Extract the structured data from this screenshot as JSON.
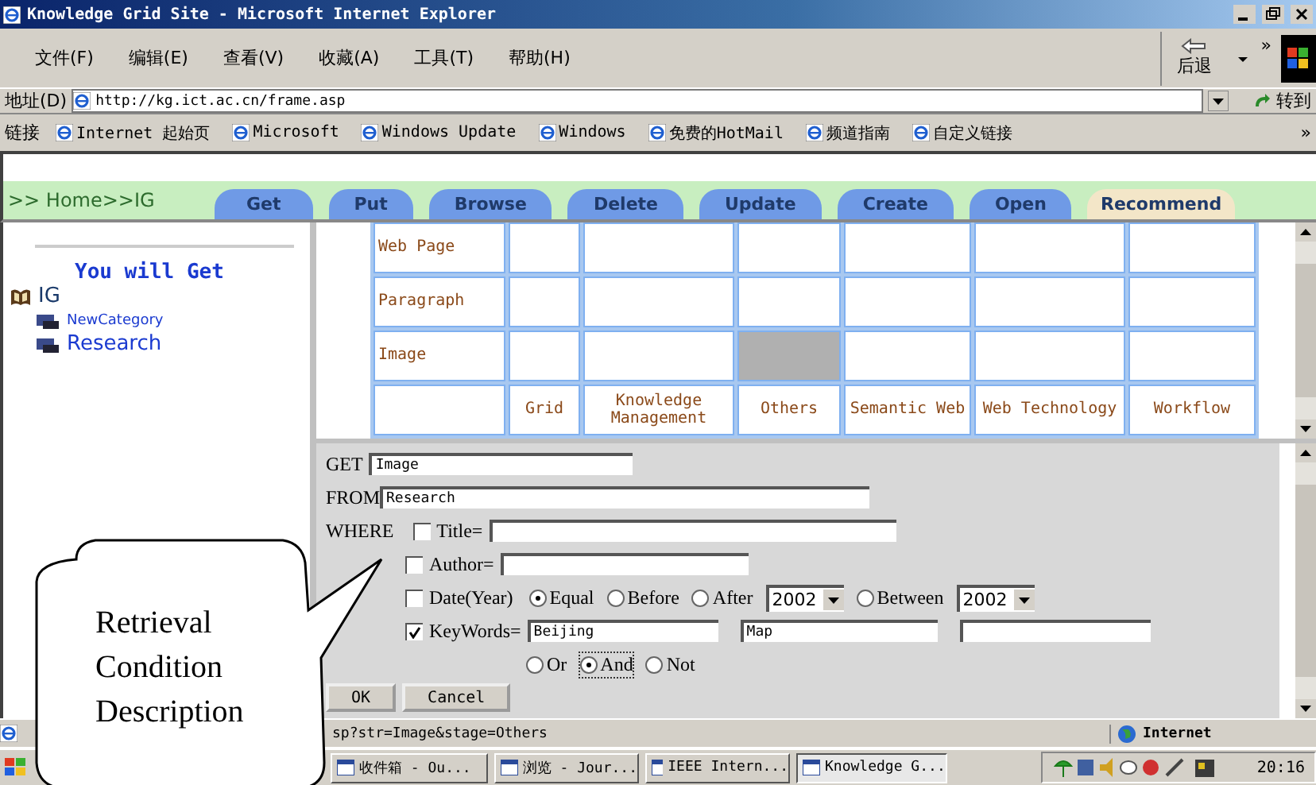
{
  "window": {
    "title": "Knowledge Grid Site - Microsoft Internet Explorer"
  },
  "menu": [
    "文件(F)",
    "编辑(E)",
    "查看(V)",
    "收藏(A)",
    "工具(T)",
    "帮助(H)"
  ],
  "back_button": {
    "label": "后退"
  },
  "chevron": "»",
  "address": {
    "label": "地址(D)",
    "url": "http://kg.ict.ac.cn/frame.asp",
    "go": "转到"
  },
  "links": {
    "label": "链接",
    "items": [
      "Internet 起始页",
      "Microsoft",
      "Windows Update",
      "Windows",
      "免费的HotMail",
      "频道指南",
      "自定义链接"
    ],
    "more": "»"
  },
  "nav": {
    "breadcrumb": ">> Home>>IG",
    "tabs": [
      {
        "label": "Get",
        "kind": "tab"
      },
      {
        "label": "Put",
        "kind": "tab"
      },
      {
        "label": "Browse",
        "kind": "tab"
      },
      {
        "label": "Delete",
        "kind": "tab"
      },
      {
        "label": "Update",
        "kind": "tab"
      },
      {
        "label": "Create",
        "kind": "tab"
      },
      {
        "label": "Open",
        "kind": "tab"
      },
      {
        "label": "Recommend",
        "kind": "plain"
      }
    ]
  },
  "sidebar": {
    "heading": "You will Get",
    "tree": [
      {
        "label": "IG",
        "children": [
          {
            "label": "NewCategory",
            "selected": false
          },
          {
            "label": "Research",
            "selected": true
          }
        ]
      }
    ]
  },
  "grid": {
    "columns": [
      "Grid",
      "Knowledge Management",
      "Others",
      "Semantic Web",
      "Web Technology",
      "Workflow"
    ],
    "rows": [
      {
        "label": "Web Page",
        "cells": [
          {
            "selected": false
          },
          {
            "selected": false
          },
          {
            "selected": false
          },
          {
            "selected": false
          },
          {
            "selected": false
          },
          {
            "selected": false
          }
        ]
      },
      {
        "label": "Paragraph",
        "cells": [
          {
            "selected": false
          },
          {
            "selected": false
          },
          {
            "selected": false
          },
          {
            "selected": false
          },
          {
            "selected": false
          },
          {
            "selected": false
          }
        ]
      },
      {
        "label": "Image",
        "cells": [
          {
            "selected": false
          },
          {
            "selected": false
          },
          {
            "selected": true
          },
          {
            "selected": false
          },
          {
            "selected": false
          },
          {
            "selected": false
          }
        ]
      }
    ]
  },
  "form": {
    "get": {
      "label": "GET",
      "value": "Image"
    },
    "from": {
      "label": "FROM",
      "value": "Research"
    },
    "where_label": "WHERE",
    "conditions": [
      {
        "kind": "text",
        "label": "Title=",
        "checked": false
      },
      {
        "kind": "text",
        "label": "Author=",
        "checked": false
      },
      {
        "kind": "date",
        "label": "Date(Year)",
        "checked": false,
        "options": [
          {
            "kind": "radio",
            "label": "Equal",
            "selected": true
          },
          {
            "kind": "radio",
            "label": "Before",
            "selected": false
          },
          {
            "kind": "radio",
            "label": "After",
            "selected": false
          },
          {
            "kind": "select",
            "value": "2002"
          },
          {
            "kind": "radio",
            "label": "Between",
            "selected": false
          },
          {
            "kind": "select",
            "value": "2002"
          }
        ]
      },
      {
        "kind": "keywords",
        "label": "KeyWords=",
        "checked": true,
        "values": [
          "Beijing",
          "Map"
        ]
      }
    ],
    "logic": [
      {
        "label": "Or",
        "selected": false
      },
      {
        "label": "And",
        "selected": true
      },
      {
        "label": "Not",
        "selected": false
      }
    ],
    "buttons": [
      "OK",
      "Cancel"
    ]
  },
  "status_bar": {
    "text": "sp?str=Image&stage=Others",
    "zone": "Internet"
  },
  "taskbar": {
    "items": [
      {
        "label": "收件箱 - Ou...",
        "selected": false
      },
      {
        "label": "浏览 - Jour...",
        "selected": false
      },
      {
        "label": "IEEE Intern...",
        "selected": false
      },
      {
        "label": "Knowledge G...",
        "selected": true
      }
    ],
    "time": "20:16"
  },
  "callout": {
    "text": "Retrieval Condition Description"
  }
}
